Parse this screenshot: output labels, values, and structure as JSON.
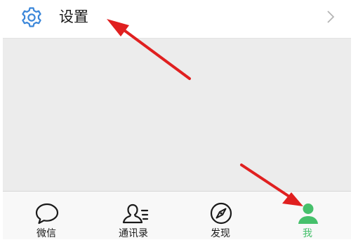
{
  "settings_row": {
    "label": "设置",
    "icon": "gear-icon",
    "trailing_icon": "chevron-right-icon"
  },
  "tabbar": {
    "tabs": [
      {
        "label": "微信",
        "icon": "chat-bubble-icon",
        "active": false
      },
      {
        "label": "通讯录",
        "icon": "contacts-icon",
        "active": false
      },
      {
        "label": "发现",
        "icon": "compass-icon",
        "active": false
      },
      {
        "label": "我",
        "icon": "person-icon",
        "active": true
      }
    ]
  },
  "colors": {
    "active": "#46c06b",
    "icon_blue": "#3a86d9",
    "annotation_arrow": "#e02020",
    "background": "#ececec"
  }
}
